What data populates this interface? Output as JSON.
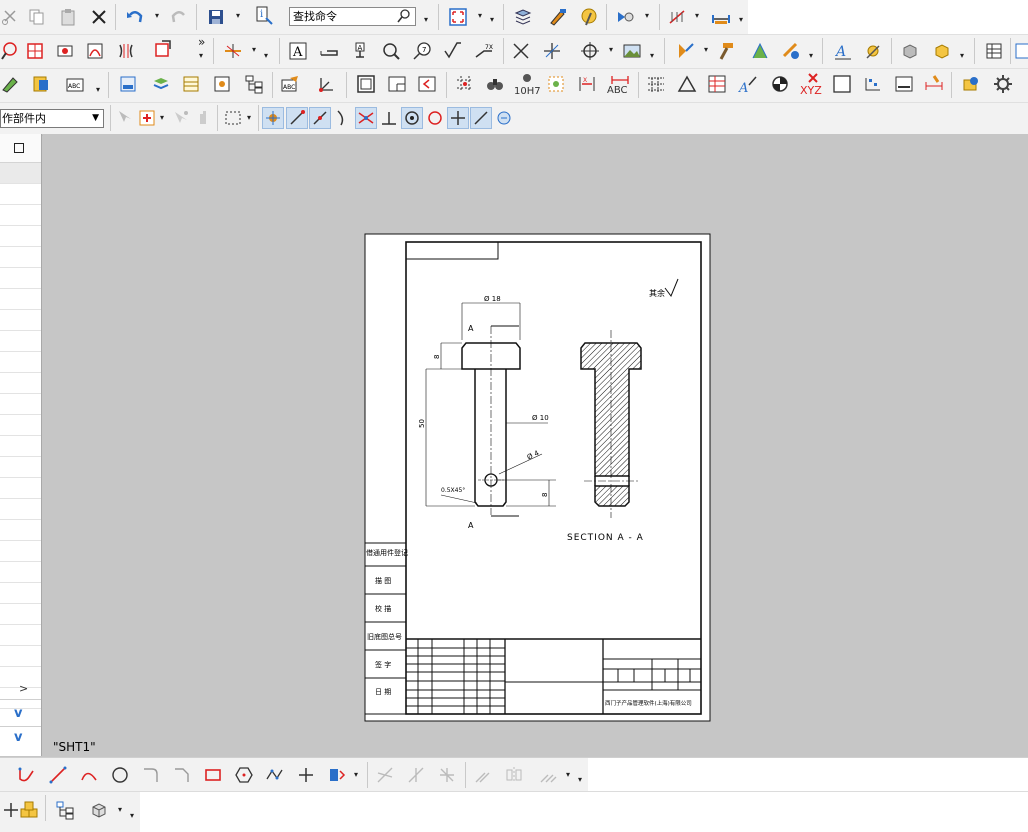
{
  "toolbar": {
    "search_placeholder": "查找命令",
    "work_part_filter": "作部件内",
    "hole_label": "10H7",
    "abc_label": "ABC",
    "xyz_label": "XYZ",
    "expand_glyph": "»"
  },
  "sheet": {
    "tab_label": "\"SHT1\""
  },
  "drawing": {
    "roughness_note": "其余",
    "dim_top_dia": "Ø 18",
    "dim_shaft_dia": "Ø 10",
    "dim_hole_dia": "Ø 4",
    "dim_length": "50",
    "dim_head": "8",
    "dim_groove": "8",
    "dim_chamfer": "0.5X45°",
    "section_mark_top": "A",
    "section_mark_bottom": "A",
    "section_title": "SECTION  A - A",
    "left_col": [
      "借通用件登记",
      "描 图",
      "校 描",
      "旧底图总号",
      "签 字",
      "日 期"
    ],
    "company": "西门子产品管理软件(上海)有限公司"
  },
  "colors": {
    "canvas": "#c6c6c6",
    "toolbar": "#f2f2f2",
    "accent_blue": "#2a6fc9",
    "accent_orange": "#e08b1a"
  }
}
